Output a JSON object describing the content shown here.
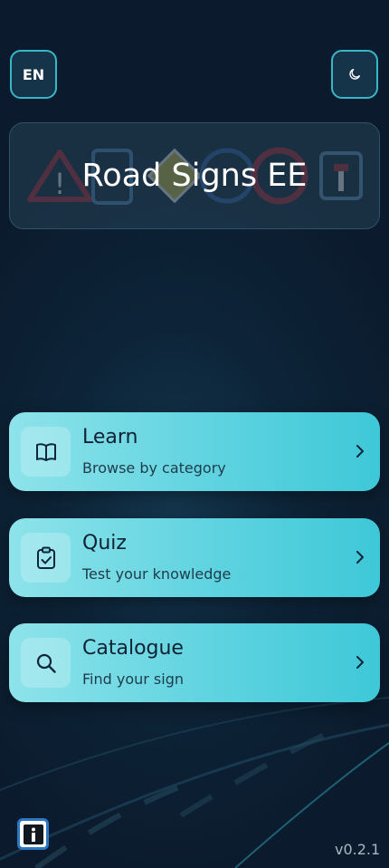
{
  "header": {
    "language_label": "EN",
    "theme_icon": "moon-icon"
  },
  "banner": {
    "title": "Road Signs EE"
  },
  "menu": [
    {
      "title": "Learn",
      "subtitle": "Browse by category",
      "icon": "book-icon"
    },
    {
      "title": "Quiz",
      "subtitle": "Test your knowledge",
      "icon": "clipboard-check-icon"
    },
    {
      "title": "Catalogue",
      "subtitle": "Find your sign",
      "icon": "search-icon"
    }
  ],
  "footer": {
    "info_icon": "info-icon",
    "version": "v0.2.1"
  },
  "colors": {
    "background": "#0b1a2c",
    "accent": "#38b7c6",
    "card": "#5fd3e0",
    "card_text": "#0f2233"
  }
}
